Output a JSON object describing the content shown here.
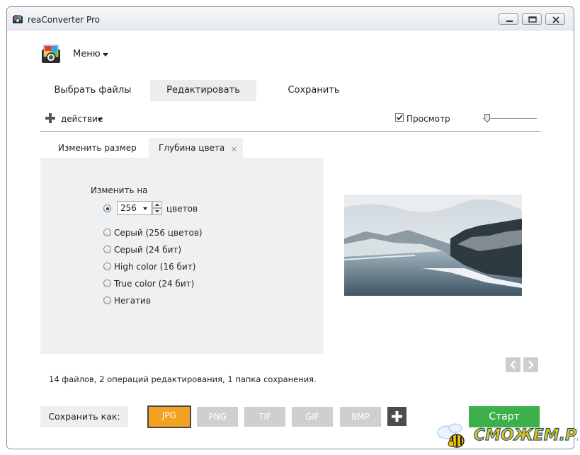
{
  "window": {
    "title": "reaConverter Pro",
    "controls": [
      "minimize-icon",
      "maximize-icon",
      "close-icon"
    ]
  },
  "menu": {
    "label": "Меню"
  },
  "steps": [
    {
      "label": "Выбрать файлы",
      "active": false
    },
    {
      "label": "Редактировать",
      "active": true
    },
    {
      "label": "Сохранить",
      "active": false
    }
  ],
  "toolbar": {
    "action_label": "действие",
    "preview_label": "Просмотр",
    "preview_checked": true
  },
  "tabs": [
    {
      "label": "Изменить размер",
      "active": false
    },
    {
      "label": "Глубина цвета",
      "active": true,
      "close_glyph": "×"
    }
  ],
  "color_depth": {
    "change_to_label": "Изменить на",
    "combo_value": "256",
    "colors_label": "цветов",
    "options": [
      {
        "label": "Серый (256 цветов)"
      },
      {
        "label": "Серый (24 бит)"
      },
      {
        "label": "High color (16 бит)"
      },
      {
        "label": "True color (24 бит)"
      },
      {
        "label": "Негатив"
      }
    ],
    "selected_index": 0
  },
  "status": "14 файлов, 2 операций редактирования, 1 папка сохранения.",
  "save_as": {
    "label": "Сохранить как:",
    "formats": [
      {
        "label": "JPG",
        "selected": true
      },
      {
        "label": "PNG",
        "selected": false
      },
      {
        "label": "TIF",
        "selected": false
      },
      {
        "label": "GIF",
        "selected": false
      },
      {
        "label": "BMP",
        "selected": false
      }
    ]
  },
  "start_label": "Старт",
  "watermark": "СМОЖЕМ.РУ",
  "colors": {
    "accent_orange": "#f2a120",
    "start_green": "#3db04b",
    "panel_bg": "#eff0f1",
    "format_gray": "#cfcfcf"
  }
}
